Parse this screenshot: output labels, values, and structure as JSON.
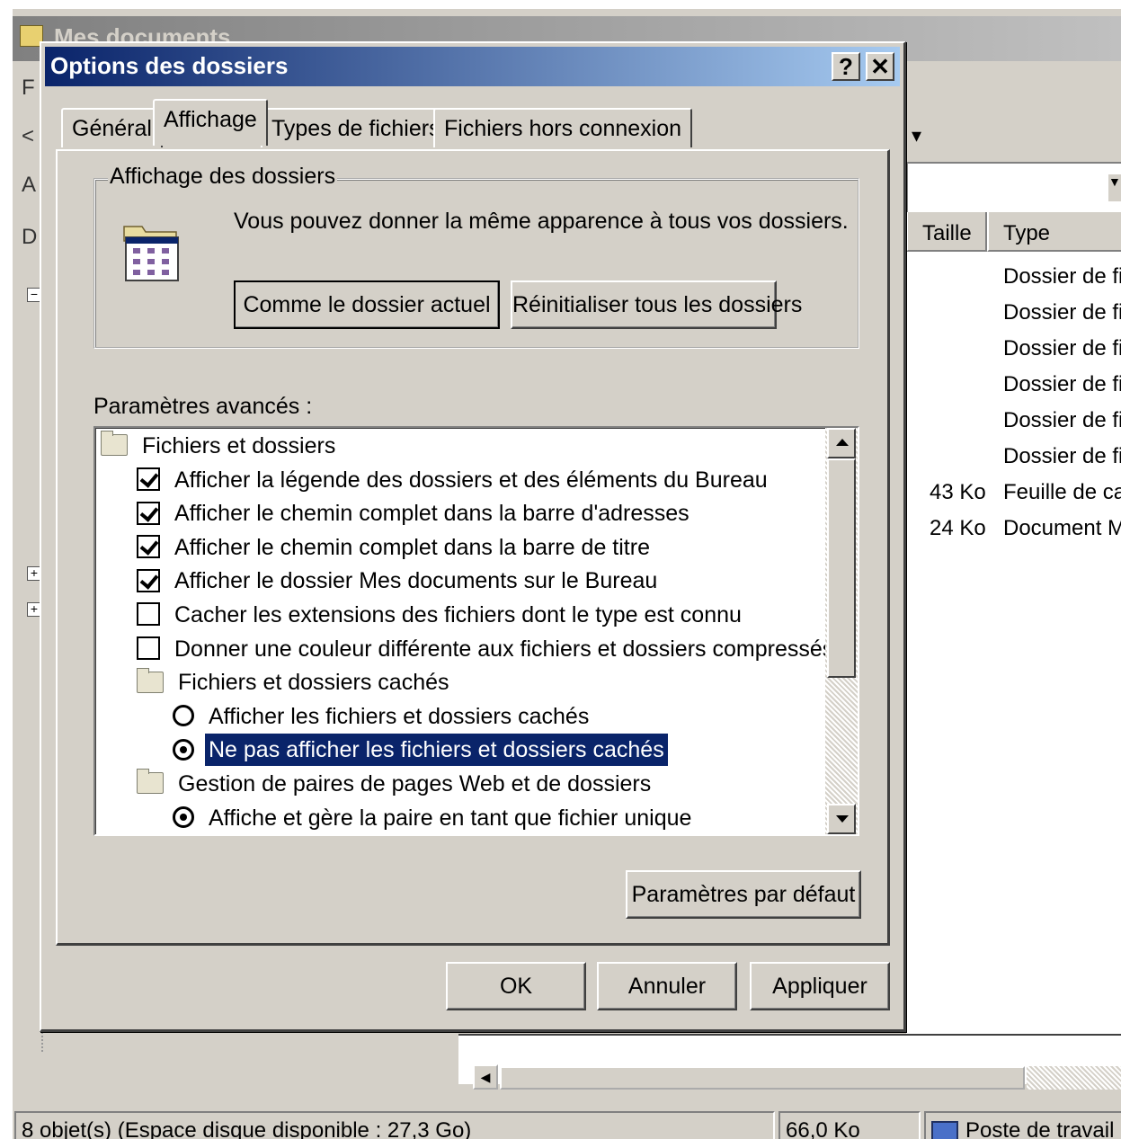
{
  "explorer": {
    "title": "Mes documents",
    "edge_letters": [
      "F",
      "<",
      "A",
      "D"
    ],
    "columns": {
      "size": "Taille",
      "type": "Type"
    },
    "rows": [
      {
        "size": "",
        "type": "Dossier de fic"
      },
      {
        "size": "",
        "type": "Dossier de fic"
      },
      {
        "size": "",
        "type": "Dossier de fic"
      },
      {
        "size": "",
        "type": "Dossier de fic"
      },
      {
        "size": "",
        "type": "Dossier de fic"
      },
      {
        "size": "",
        "type": "Dossier de fic"
      },
      {
        "size": "43 Ko",
        "type": "Feuille de cal"
      },
      {
        "size": "24 Ko",
        "type": "Document Mi"
      }
    ],
    "status": {
      "objects": "8 objet(s) (Espace disque disponible : 27,3 Go)",
      "size": "66,0 Ko",
      "location": "Poste de travail"
    }
  },
  "dialog": {
    "title": "Options des dossiers",
    "help_glyph": "?",
    "close_glyph": "✕",
    "tabs": [
      "Général",
      "Affichage",
      "Types de fichiers",
      "Fichiers hors connexion"
    ],
    "active_tab": "Affichage",
    "folder_view": {
      "legend": "Affichage des dossiers",
      "description": "Vous pouvez donner la même apparence à tous vos dossiers.",
      "like_current_button": "Comme le dossier actuel",
      "reset_all_button": "Réinitialiser tous les dossiers"
    },
    "advanced": {
      "label": "Paramètres avancés :",
      "items": [
        {
          "kind": "folder",
          "label": "Fichiers et dossiers"
        },
        {
          "kind": "checkbox",
          "checked": true,
          "label": "Afficher la légende des dossiers et des éléments du Bureau"
        },
        {
          "kind": "checkbox",
          "checked": true,
          "label": "Afficher le chemin complet dans la barre d'adresses"
        },
        {
          "kind": "checkbox",
          "checked": true,
          "label": "Afficher le chemin complet dans la barre de titre"
        },
        {
          "kind": "checkbox",
          "checked": true,
          "label": "Afficher le dossier Mes documents sur le Bureau"
        },
        {
          "kind": "checkbox",
          "checked": false,
          "label": "Cacher les extensions des fichiers dont le type est connu"
        },
        {
          "kind": "checkbox",
          "checked": false,
          "label": "Donner une couleur différente aux fichiers et dossiers compressés"
        },
        {
          "kind": "folder",
          "label": "Fichiers et dossiers cachés"
        },
        {
          "kind": "radio",
          "checked": false,
          "label": "Afficher les fichiers et dossiers cachés"
        },
        {
          "kind": "radio",
          "checked": true,
          "selected": true,
          "label": "Ne pas afficher les fichiers et dossiers cachés"
        },
        {
          "kind": "folder",
          "label": "Gestion de paires de pages Web et de dossiers"
        },
        {
          "kind": "radio",
          "checked": true,
          "label": "Affiche et gère la paire en tant que fichier unique"
        }
      ],
      "restore_defaults_button": "Paramètres par défaut"
    },
    "buttons": {
      "ok": "OK",
      "cancel": "Annuler",
      "apply": "Appliquer"
    }
  },
  "colors": {
    "titlebar_active": "#0a246a",
    "selection": "#0a246a",
    "face": "#d4d0c8"
  }
}
